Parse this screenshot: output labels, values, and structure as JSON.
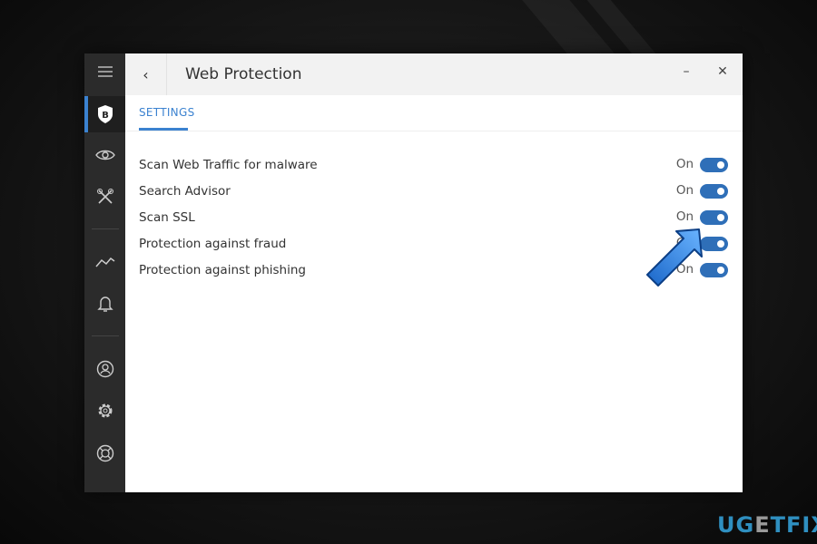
{
  "window": {
    "title": "Web Protection",
    "back_icon": "chevron-left-icon",
    "minimize": "–",
    "close": "✕"
  },
  "sidebar": {
    "items": [
      "menu-icon",
      "bitdefender-shield-icon",
      "eye-icon",
      "tools-icon",
      "activity-icon",
      "bell-icon",
      "account-icon",
      "gear-icon",
      "support-icon"
    ],
    "active": "bitdefender-shield-icon"
  },
  "tabs": [
    {
      "label": "SETTINGS",
      "active": true
    }
  ],
  "settings": [
    {
      "label": "Scan Web Traffic for malware",
      "state": "On",
      "enabled": true
    },
    {
      "label": "Search Advisor",
      "state": "On",
      "enabled": true
    },
    {
      "label": "Scan SSL",
      "state": "On",
      "enabled": true
    },
    {
      "label": "Protection against fraud",
      "state": "On",
      "enabled": true
    },
    {
      "label": "Protection against phishing",
      "state": "On",
      "enabled": true
    }
  ],
  "colors": {
    "accent": "#3b82d0",
    "toggle": "#2f6fb8",
    "sidebar": "#2b2b2b"
  },
  "watermark": {
    "text": "UGETFIX"
  }
}
